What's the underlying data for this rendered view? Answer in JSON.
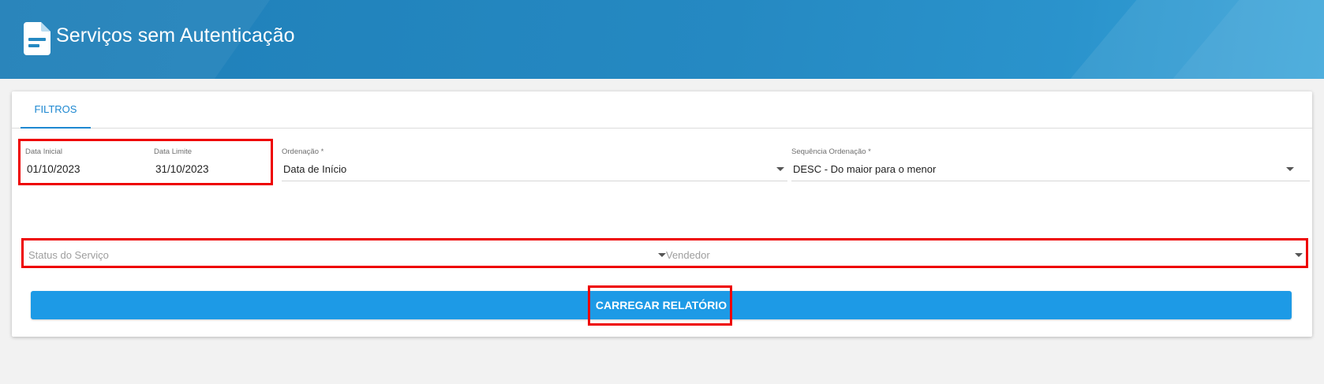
{
  "header": {
    "title": "Serviços sem Autenticação",
    "icon": "document-icon"
  },
  "tabs": [
    {
      "label": "FILTROS",
      "active": true
    }
  ],
  "filters": {
    "data_inicial": {
      "label": "Data Inicial",
      "value": "01/10/2023"
    },
    "data_limite": {
      "label": "Data Limite",
      "value": "31/10/2023"
    },
    "ordenacao": {
      "label": "Ordenação *",
      "value": "Data de Início"
    },
    "sequencia": {
      "label": "Sequência Ordenação *",
      "value": "DESC - Do maior para o menor"
    },
    "status": {
      "placeholder": "Status do Serviço"
    },
    "vendedor": {
      "placeholder": "Vendedor"
    }
  },
  "actions": {
    "load_report": "CARREGAR RELATÓRIO"
  },
  "colors": {
    "header": "#2589c2",
    "accent": "#1e88d1",
    "button": "#1d9ae6",
    "highlight": "#ee0000"
  }
}
